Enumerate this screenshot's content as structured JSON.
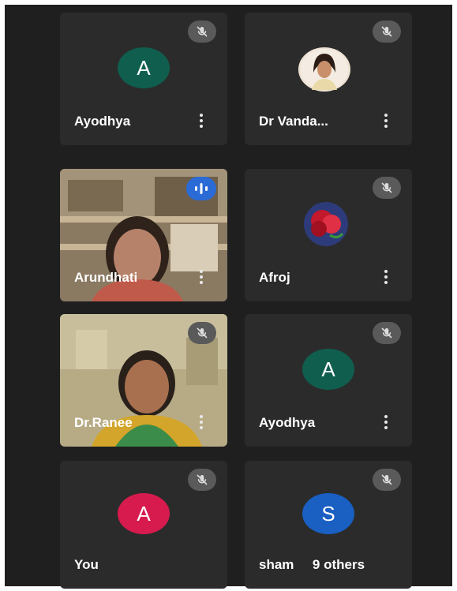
{
  "participants": [
    {
      "name": "Ayodhya",
      "initial": "A",
      "avatar_color": "#0f5e4e",
      "muted": true
    },
    {
      "name": "Dr Vanda...",
      "muted": true,
      "avatar": "profile-photo"
    },
    {
      "name": "Arundhati",
      "muted": false,
      "speaking": true,
      "video": true
    },
    {
      "name": "Afroj",
      "muted": true,
      "avatar": "rose-photo"
    },
    {
      "name": "Dr.Ranee",
      "muted": true,
      "video": true
    },
    {
      "name": "Ayodhya",
      "initial": "A",
      "avatar_color": "#0f5e4e",
      "muted": true
    },
    {
      "name": "You",
      "initial": "A",
      "avatar_color": "#d81b4f",
      "muted": true
    },
    {
      "name": "sham",
      "initial": "S",
      "avatar_color": "#1a5fc2",
      "muted": true,
      "others_label": "9 others"
    }
  ]
}
